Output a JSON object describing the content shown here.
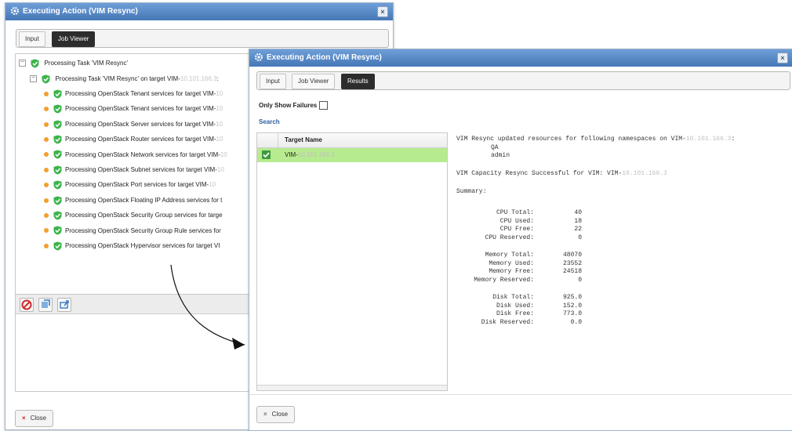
{
  "back_window": {
    "title": "Executing Action (VIM Resync)",
    "tabs": [
      {
        "label": "Input",
        "active": false
      },
      {
        "label": "Job Viewer",
        "active": true
      }
    ],
    "tree": {
      "root": "Processing Task 'VIM Resync'",
      "child_prefix": "Processing Task 'VIM Resync' on target VIM-",
      "child_ip": "10.101.166.3",
      "child_suffix": ":",
      "items": [
        "Processing OpenStack Tenant services for target VIM-",
        "Processing OpenStack Tenant services for target VIM-",
        "Processing OpenStack Server services for target VIM-",
        "Processing OpenStack Router services for target VIM-",
        "Processing OpenStack Network services for target VIM-",
        "Processing OpenStack Subnet services for target VIM-",
        "Processing OpenStack Port services for target VIM-",
        "Processing OpenStack Floating IP Address services for t",
        "Processing OpenStack Security Group services for targe",
        "Processing OpenStack Security Group Rule services for",
        "Processing OpenStack Hypervisor services for target VI"
      ],
      "item_ip": "10"
    },
    "close_label": "Close"
  },
  "front_window": {
    "title": "Executing Action (VIM Resync)",
    "tabs": [
      {
        "label": "Input",
        "active": false
      },
      {
        "label": "Job Viewer",
        "active": false
      },
      {
        "label": "Results",
        "active": true
      }
    ],
    "only_show_failures_label": "Only Show Failures",
    "search_label": "Search",
    "table": {
      "column_header": "Target Name",
      "rows": [
        {
          "prefix": "VIM-",
          "ip": "10.101.166.3",
          "checked": true
        }
      ]
    },
    "results": {
      "line1_prefix": "VIM Resync updated resources for following namespaces on VIM-",
      "line1_ip": "10.101.166.3",
      "line1_suffix": ":",
      "namespaces": [
        "QA",
        "admin"
      ],
      "capacity_prefix": "VIM Capacity Resync Successful for VIM: VIM-",
      "capacity_ip": "10.101.166.3",
      "summary_label": "Summary:",
      "cpu": [
        {
          "label": "CPU Total:",
          "value": "40"
        },
        {
          "label": "CPU Used:",
          "value": "18"
        },
        {
          "label": "CPU Free:",
          "value": "22"
        },
        {
          "label": "CPU Reserved:",
          "value": "0"
        }
      ],
      "memory": [
        {
          "label": "Memory Total:",
          "value": "48070"
        },
        {
          "label": "Memory Used:",
          "value": "23552"
        },
        {
          "label": "Memory Free:",
          "value": "24518"
        },
        {
          "label": "Memory Reserved:",
          "value": "0"
        }
      ],
      "disk": [
        {
          "label": "Disk Total:",
          "value": "925.0"
        },
        {
          "label": "Disk Used:",
          "value": "152.0"
        },
        {
          "label": "Disk Free:",
          "value": "773.0"
        },
        {
          "label": "Disk Reserved:",
          "value": "0.0"
        }
      ]
    },
    "close_label": "Close"
  },
  "colors": {
    "title_bar": "#4f81bd",
    "selected_row": "#b7eb8f",
    "success_green": "#3cb44b",
    "pending_orange": "#f0a030"
  }
}
